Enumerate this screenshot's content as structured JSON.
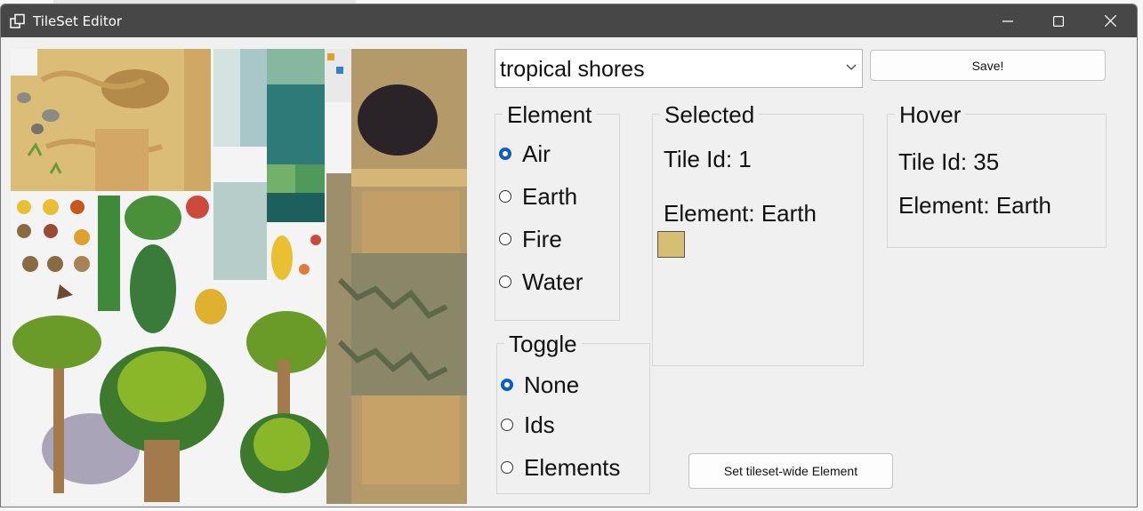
{
  "window": {
    "title": "TileSet Editor"
  },
  "tileset_dropdown": {
    "selected": "tropical shores"
  },
  "toolbar": {
    "save_label": "Save!",
    "tileset_wide_label": "Set tileset-wide Element"
  },
  "element_group": {
    "title": "Element",
    "options": [
      {
        "label": "Air",
        "checked": true
      },
      {
        "label": "Earth",
        "checked": false
      },
      {
        "label": "Fire",
        "checked": false
      },
      {
        "label": "Water",
        "checked": false
      }
    ]
  },
  "toggle_group": {
    "title": "Toggle",
    "options": [
      {
        "label": "None",
        "checked": true
      },
      {
        "label": "Ids",
        "checked": false
      },
      {
        "label": "Elements",
        "checked": false
      }
    ]
  },
  "selected_group": {
    "title": "Selected",
    "tile_id": "Tile Id: 1",
    "element": "Element: Earth",
    "swatch_color": "#d4bf72"
  },
  "hover_group": {
    "title": "Hover",
    "tile_id": "Tile Id: 35",
    "element": "Element: Earth"
  },
  "colors": {
    "titlebar": "#474747",
    "accent": "#0a5fbf"
  }
}
